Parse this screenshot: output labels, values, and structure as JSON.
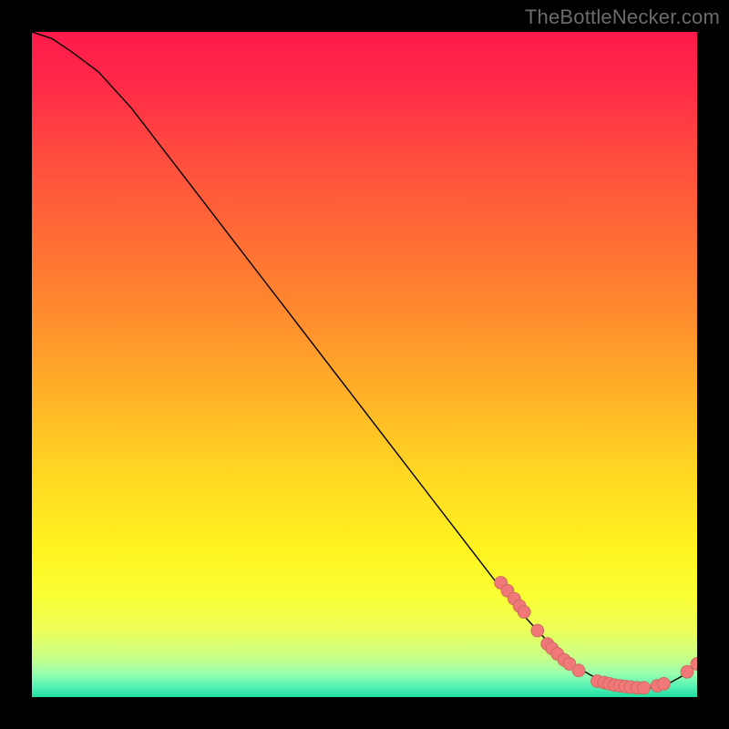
{
  "watermark": "TheBottleNecker.com",
  "colors": {
    "black": "#000000",
    "curve": "#000000",
    "marker_fill": "#f07878",
    "marker_stroke": "#c96a5a"
  },
  "chart_data": {
    "type": "line",
    "title": "",
    "xlabel": "",
    "ylabel": "",
    "xlim": [
      0,
      100
    ],
    "ylim": [
      0,
      100
    ],
    "grid": false,
    "legend": false,
    "gradient_stops": [
      {
        "offset": 0.0,
        "color": "#ff1a4b"
      },
      {
        "offset": 0.08,
        "color": "#ff2a48"
      },
      {
        "offset": 0.18,
        "color": "#ff4a3f"
      },
      {
        "offset": 0.3,
        "color": "#ff6a36"
      },
      {
        "offset": 0.42,
        "color": "#ff8a2e"
      },
      {
        "offset": 0.55,
        "color": "#ffb327"
      },
      {
        "offset": 0.67,
        "color": "#ffd922"
      },
      {
        "offset": 0.78,
        "color": "#fff420"
      },
      {
        "offset": 0.85,
        "color": "#f9ff35"
      },
      {
        "offset": 0.9,
        "color": "#ecff5a"
      },
      {
        "offset": 0.94,
        "color": "#c9ff87"
      },
      {
        "offset": 0.965,
        "color": "#98ffaf"
      },
      {
        "offset": 0.985,
        "color": "#54f2b6"
      },
      {
        "offset": 1.0,
        "color": "#1edca0"
      }
    ],
    "series": [
      {
        "name": "bottleneck-curve",
        "x": [
          0,
          3,
          6,
          10,
          15,
          20,
          25,
          30,
          35,
          40,
          45,
          50,
          55,
          60,
          65,
          70,
          72,
          74,
          76,
          78,
          80,
          82,
          84,
          86,
          88,
          90,
          92,
          94,
          96,
          98,
          100
        ],
        "y": [
          100,
          99,
          97,
          94,
          88.5,
          82,
          75.5,
          69,
          62.5,
          56,
          49.5,
          43,
          36.5,
          30,
          23.5,
          17,
          14.5,
          12.2,
          10,
          7.9,
          6,
          4.5,
          3.3,
          2.4,
          1.7,
          1.3,
          1.2,
          1.5,
          2.2,
          3.3,
          5
        ]
      }
    ],
    "markers": [
      {
        "x": 70.5,
        "y": 17.2
      },
      {
        "x": 71.5,
        "y": 16.0
      },
      {
        "x": 72.5,
        "y": 14.8
      },
      {
        "x": 73.3,
        "y": 13.7
      },
      {
        "x": 74.0,
        "y": 12.8
      },
      {
        "x": 76.0,
        "y": 10.0
      },
      {
        "x": 77.5,
        "y": 8.0
      },
      {
        "x": 78.2,
        "y": 7.3
      },
      {
        "x": 79.0,
        "y": 6.5
      },
      {
        "x": 80.0,
        "y": 5.6
      },
      {
        "x": 80.8,
        "y": 5.0
      },
      {
        "x": 82.2,
        "y": 4.0
      },
      {
        "x": 85.0,
        "y": 2.4
      },
      {
        "x": 86.0,
        "y": 2.2
      },
      {
        "x": 86.8,
        "y": 2.0
      },
      {
        "x": 87.6,
        "y": 1.8
      },
      {
        "x": 88.4,
        "y": 1.7
      },
      {
        "x": 89.2,
        "y": 1.6
      },
      {
        "x": 90.0,
        "y": 1.5
      },
      {
        "x": 91.0,
        "y": 1.4
      },
      {
        "x": 92.0,
        "y": 1.4
      },
      {
        "x": 94.0,
        "y": 1.7
      },
      {
        "x": 95.0,
        "y": 2.0
      },
      {
        "x": 98.5,
        "y": 3.8
      },
      {
        "x": 100.0,
        "y": 5.0
      }
    ]
  }
}
